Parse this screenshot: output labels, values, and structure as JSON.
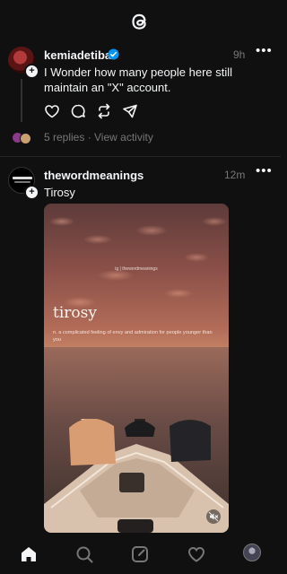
{
  "app": {
    "logo_icon": "threads-logo-icon"
  },
  "posts": [
    {
      "username": "kemiadetiba",
      "verified": true,
      "time": "9h",
      "text": "I Wonder how many people here still maintain an \"X\" account.",
      "replies_text": "5 replies · View activity"
    },
    {
      "username": "thewordmeanings",
      "verified": false,
      "time": "12m",
      "text": "Tirosy",
      "media": {
        "handle": "ig | thewordmeanings",
        "headword": "tirosy",
        "definition": "n. a complicated feeling of envy and admiration for people younger than you"
      }
    }
  ],
  "nav": {
    "items": [
      "home-icon",
      "search-icon",
      "compose-icon",
      "activity-heart-icon",
      "profile-avatar"
    ]
  },
  "colors": {
    "background": "#101010",
    "text": "#f3f5f7",
    "muted": "#777777",
    "verified": "#0095f6"
  }
}
